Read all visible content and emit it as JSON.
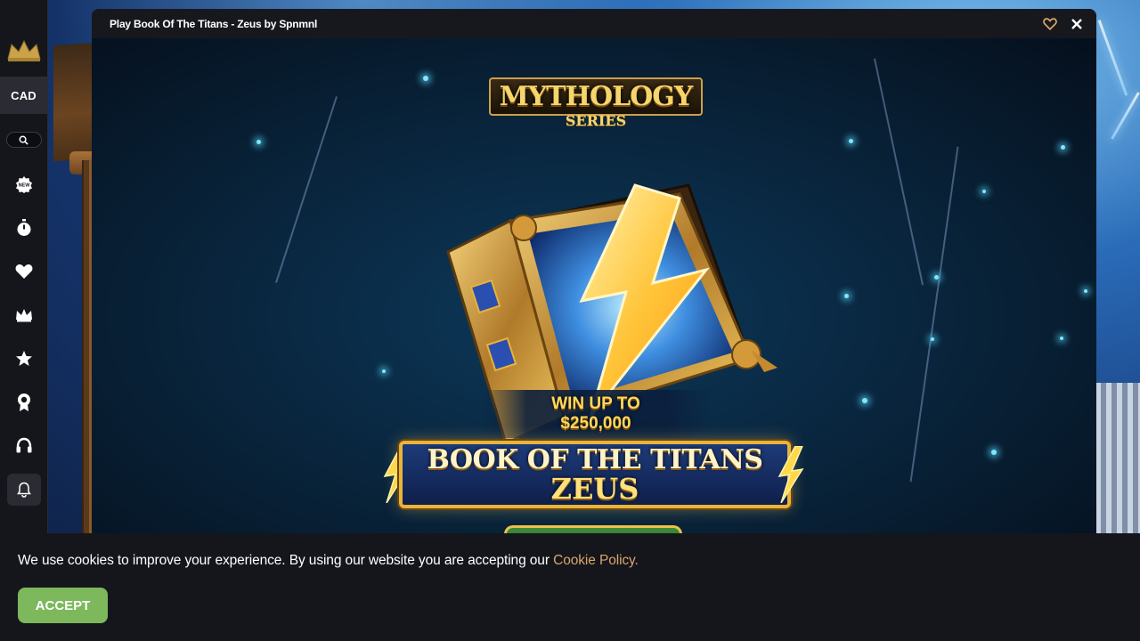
{
  "sidebar": {
    "logo_icon": "crown-logo-icon",
    "currency": "CAD",
    "search_icon": "search-icon",
    "nav_icons": [
      "new-badge-icon",
      "stopwatch-icon",
      "heart-icon",
      "crown-icon",
      "star-icon",
      "award-ribbon-icon",
      "headset-icon"
    ],
    "bell_icon": "bell-icon"
  },
  "modal": {
    "title": "Play Book Of The Titans - Zeus by Spnmnl",
    "favorite_icon": "heart-outline-icon",
    "close_icon": "close-icon",
    "favorite_color": "#d9a56a"
  },
  "game": {
    "series_main": "MYTHOLOGY",
    "series_sub": "SERIES",
    "win_line1": "WIN UP TO",
    "win_line2": "$250,000",
    "title_line1": "BOOK OF THE TITANS",
    "title_line2": "ZEUS"
  },
  "cookie": {
    "message": "We use cookies to improve your experience. By using our website you are accepting our ",
    "link_text": "Cookie Policy.",
    "accept_label": "ACCEPT",
    "link_color": "#d9a56a",
    "accept_color": "#7db85c"
  }
}
